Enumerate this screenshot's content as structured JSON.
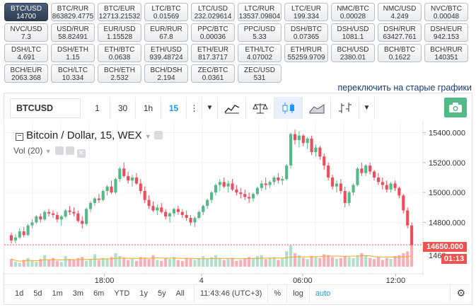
{
  "pairs": [
    {
      "name": "BTC/USD",
      "price": "14700",
      "active": true
    },
    {
      "name": "BTC/RUR",
      "price": "863829.4775"
    },
    {
      "name": "BTC/EUR",
      "price": "12713.21532"
    },
    {
      "name": "LTC/BTC",
      "price": "0.01569"
    },
    {
      "name": "LTC/USD",
      "price": "232.029614"
    },
    {
      "name": "LTC/RUR",
      "price": "13537.09804"
    },
    {
      "name": "LTC/EUR",
      "price": "199.334"
    },
    {
      "name": "NMC/BTC",
      "price": "0.00028"
    },
    {
      "name": "NMC/USD",
      "price": "4.249"
    },
    {
      "name": "NVC/BTC",
      "price": "0.00048"
    },
    {
      "name": "NVC/USD",
      "price": "7.3"
    },
    {
      "name": "USD/RUR",
      "price": "58.82491"
    },
    {
      "name": "EUR/USD",
      "price": "1.15528"
    },
    {
      "name": "EUR/RUR",
      "price": "67.8"
    },
    {
      "name": "PPC/BTC",
      "price": "0.00036"
    },
    {
      "name": "PPC/USD",
      "price": "5.33"
    },
    {
      "name": "DSH/BTC",
      "price": "0.07365"
    },
    {
      "name": "DSH/USD",
      "price": "1081.1"
    },
    {
      "name": "DSH/RUR",
      "price": "63427.761"
    },
    {
      "name": "DSH/EUR",
      "price": "942.153"
    },
    {
      "name": "DSH/LTC",
      "price": "4.691"
    },
    {
      "name": "DSH/ETH",
      "price": "1.15"
    },
    {
      "name": "ETH/BTC",
      "price": "0.0638"
    },
    {
      "name": "ETH/USD",
      "price": "939.48724"
    },
    {
      "name": "ETH/EUR",
      "price": "817.3717"
    },
    {
      "name": "ETH/LTC",
      "price": "4.07002"
    },
    {
      "name": "ETH/RUR",
      "price": "55259.9709"
    },
    {
      "name": "BCH/USD",
      "price": "2380.01"
    },
    {
      "name": "BCH/BTC",
      "price": "0.1622"
    },
    {
      "name": "BCH/RUR",
      "price": "140351"
    },
    {
      "name": "BCH/EUR",
      "price": "2063.368"
    },
    {
      "name": "BCH/LTC",
      "price": "10.334"
    },
    {
      "name": "BCH/ETH",
      "price": "2.532"
    },
    {
      "name": "BCH/DSH",
      "price": "2.194"
    },
    {
      "name": "ZEC/BTC",
      "price": "0.0361"
    },
    {
      "name": "ZEC/USD",
      "price": "531"
    }
  ],
  "switch_link": "переключить на старые графики",
  "toolbar": {
    "symbol": "BTCUSD",
    "intervals": [
      "1",
      "30",
      "1h",
      "15"
    ],
    "selected_interval": "15"
  },
  "legend": {
    "title": "Bitcoin / Dollar, 15, WEX",
    "volume": "Vol (20)"
  },
  "price_tags": {
    "last": "14650.000",
    "countdown": "01:13"
  },
  "colors": {
    "up": "#53b987",
    "down": "#eb4d5c",
    "accent": "#2196f3"
  },
  "bottombar": {
    "ranges": [
      "1d",
      "5d",
      "1m",
      "3m",
      "6m",
      "YTD",
      "1y",
      "5y",
      "All"
    ],
    "time": "11:43:46 (UTC+3)",
    "percent": "%",
    "log": "log",
    "auto": "auto"
  },
  "chart_data": {
    "type": "candlestick",
    "symbol": "Bitcoin / Dollar",
    "interval": "15",
    "exchange": "WEX",
    "y_ticks": [
      15400,
      15200,
      15000,
      14800
    ],
    "y_tick_labels": [
      "15400.000",
      "15200.000",
      "15000.000",
      "14800.000",
      "1460"
    ],
    "ylim": [
      14580,
      15440
    ],
    "x_tick_labels": [
      "18:00",
      "4",
      "06:00",
      "12:00"
    ],
    "candles": [
      [
        14715,
        14730,
        14660,
        14680
      ],
      [
        14680,
        14720,
        14660,
        14700
      ],
      [
        14700,
        14760,
        14690,
        14740
      ],
      [
        14740,
        14770,
        14700,
        14715
      ],
      [
        14715,
        14790,
        14710,
        14780
      ],
      [
        14780,
        14820,
        14760,
        14800
      ],
      [
        14800,
        14850,
        14790,
        14840
      ],
      [
        14840,
        14860,
        14800,
        14820
      ],
      [
        14820,
        14880,
        14810,
        14870
      ],
      [
        14870,
        14890,
        14840,
        14860
      ],
      [
        14860,
        14880,
        14830,
        14850
      ],
      [
        14850,
        14870,
        14800,
        14820
      ],
      [
        14820,
        14850,
        14780,
        14840
      ],
      [
        14840,
        14890,
        14830,
        14880
      ],
      [
        14880,
        14910,
        14850,
        14870
      ],
      [
        14870,
        14900,
        14840,
        14860
      ],
      [
        14860,
        14880,
        14800,
        14810
      ],
      [
        14810,
        14840,
        14760,
        14790
      ],
      [
        14790,
        14900,
        14780,
        14890
      ],
      [
        14890,
        14940,
        14870,
        14930
      ],
      [
        14930,
        14970,
        14910,
        14960
      ],
      [
        14960,
        14990,
        14930,
        14950
      ],
      [
        14950,
        15020,
        14940,
        15010
      ],
      [
        15010,
        15050,
        14980,
        15040
      ],
      [
        15040,
        15080,
        14990,
        15000
      ],
      [
        15000,
        15100,
        14990,
        15090
      ],
      [
        15090,
        15170,
        15070,
        15160
      ],
      [
        15160,
        15200,
        15100,
        15110
      ],
      [
        15110,
        15140,
        15060,
        15080
      ],
      [
        15080,
        15120,
        15040,
        15100
      ],
      [
        15100,
        15130,
        15050,
        15060
      ],
      [
        15060,
        15090,
        14990,
        15010
      ],
      [
        15010,
        15040,
        14930,
        14950
      ],
      [
        14950,
        14980,
        14890,
        14910
      ],
      [
        14910,
        14940,
        14870,
        14880
      ],
      [
        14880,
        14920,
        14850,
        14900
      ],
      [
        14900,
        14930,
        14860,
        14870
      ],
      [
        14870,
        14890,
        14820,
        14840
      ],
      [
        14840,
        14870,
        14800,
        14860
      ],
      [
        14860,
        14900,
        14840,
        14890
      ],
      [
        14890,
        14910,
        14850,
        14870
      ],
      [
        14870,
        14890,
        14830,
        14850
      ],
      [
        14850,
        14880,
        14810,
        14830
      ],
      [
        14830,
        14850,
        14780,
        14800
      ],
      [
        14800,
        14840,
        14770,
        14830
      ],
      [
        14830,
        14880,
        14820,
        14870
      ],
      [
        14870,
        14920,
        14850,
        14910
      ],
      [
        14910,
        14960,
        14890,
        14950
      ],
      [
        14950,
        15010,
        14930,
        15000
      ],
      [
        15000,
        15060,
        14980,
        15050
      ],
      [
        15050,
        15090,
        15010,
        15070
      ],
      [
        15070,
        15100,
        15030,
        15040
      ],
      [
        15040,
        15080,
        15000,
        15060
      ],
      [
        15060,
        15090,
        15010,
        15020
      ],
      [
        15020,
        15050,
        14980,
        15000
      ],
      [
        15000,
        15030,
        14960,
        14990
      ],
      [
        14990,
        15020,
        14950,
        14970
      ],
      [
        14970,
        15000,
        14930,
        14960
      ],
      [
        14960,
        15000,
        14940,
        14990
      ],
      [
        14990,
        15040,
        14980,
        15030
      ],
      [
        15030,
        15080,
        15010,
        15060
      ],
      [
        15060,
        15100,
        15020,
        15050
      ],
      [
        15050,
        15080,
        15030,
        15070
      ],
      [
        15070,
        15110,
        15050,
        15100
      ],
      [
        15100,
        15130,
        15060,
        15080
      ],
      [
        15080,
        15110,
        15050,
        15090
      ],
      [
        15090,
        15190,
        15080,
        15180
      ],
      [
        15180,
        15400,
        15160,
        15390
      ],
      [
        15390,
        15420,
        15320,
        15350
      ],
      [
        15350,
        15410,
        15300,
        15380
      ],
      [
        15380,
        15390,
        15310,
        15330
      ],
      [
        15330,
        15370,
        15290,
        15360
      ],
      [
        15360,
        15380,
        15250,
        15270
      ],
      [
        15270,
        15320,
        15240,
        15300
      ],
      [
        15300,
        15310,
        15220,
        15240
      ],
      [
        15240,
        15260,
        15150,
        15180
      ],
      [
        15180,
        15200,
        15080,
        15100
      ],
      [
        15100,
        15120,
        15020,
        15040
      ],
      [
        15040,
        15080,
        15000,
        15060
      ],
      [
        15060,
        15090,
        14990,
        15010
      ],
      [
        15010,
        15040,
        14900,
        14930
      ],
      [
        14930,
        15010,
        14910,
        15000
      ],
      [
        15000,
        15060,
        14980,
        15050
      ],
      [
        15050,
        15170,
        15040,
        15160
      ],
      [
        15160,
        15200,
        15110,
        15130
      ],
      [
        15130,
        15190,
        15110,
        15180
      ],
      [
        15180,
        15200,
        15120,
        15140
      ],
      [
        15140,
        15150,
        15080,
        15100
      ],
      [
        15100,
        15130,
        15050,
        15070
      ],
      [
        15070,
        15100,
        15020,
        15050
      ],
      [
        15050,
        15080,
        15000,
        15020
      ],
      [
        15020,
        15070,
        15000,
        15060
      ],
      [
        15060,
        15080,
        15010,
        15030
      ],
      [
        15030,
        15040,
        14960,
        14980
      ],
      [
        14980,
        14990,
        14860,
        14880
      ],
      [
        14880,
        14900,
        14760,
        14780
      ],
      [
        14780,
        14800,
        14640,
        14650
      ]
    ],
    "volume": [
      8,
      5,
      4,
      7,
      9,
      6,
      5,
      8,
      12,
      7,
      9,
      6,
      5,
      11,
      8,
      7,
      9,
      10,
      6,
      8,
      13,
      7,
      9,
      8,
      10,
      14,
      11,
      9,
      7,
      8,
      6,
      10,
      9,
      8,
      12,
      7,
      6,
      9,
      8,
      10,
      7,
      6,
      9,
      8,
      7,
      9,
      11,
      8,
      10,
      12,
      9,
      7,
      8,
      9,
      6,
      7,
      8,
      10,
      9,
      11,
      12,
      8,
      9,
      10,
      7,
      9,
      16,
      22,
      14,
      12,
      9,
      8,
      11,
      10,
      9,
      13,
      12,
      10,
      8,
      9,
      11,
      10,
      9,
      12,
      14,
      11,
      9,
      8,
      10,
      7,
      9,
      8,
      11,
      12,
      14,
      16,
      25
    ]
  }
}
